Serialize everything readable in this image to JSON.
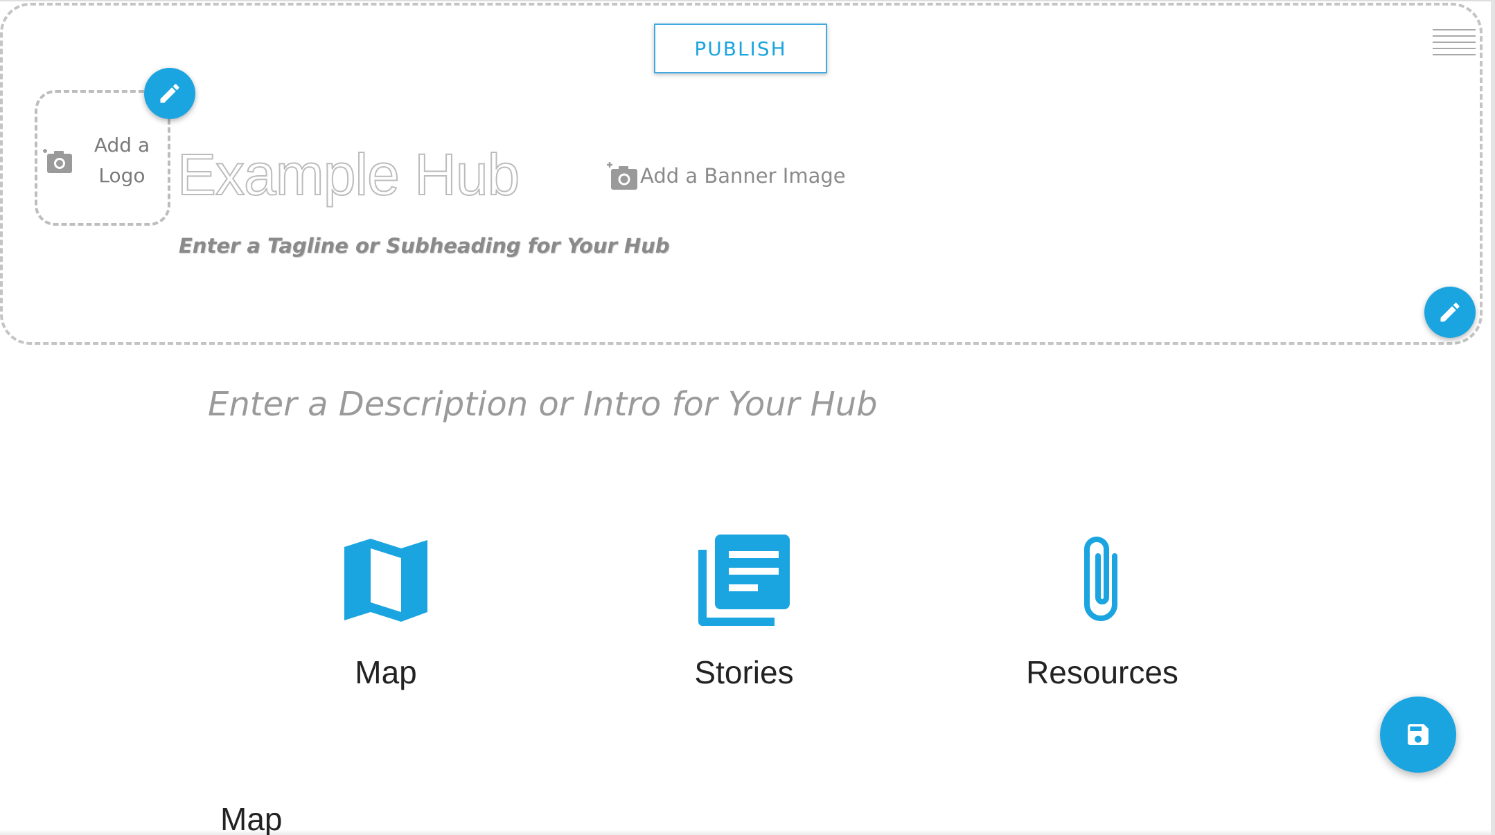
{
  "header": {
    "publish_label": "PUBLISH",
    "logo_label_line1": "Add a",
    "logo_label_line2": "Logo",
    "title": "Example Hub",
    "tagline": "Enter a Tagline or Subheading for Your Hub",
    "banner_label": "Add a Banner Image"
  },
  "main": {
    "description": "Enter a Description or Intro for Your Hub",
    "features": [
      {
        "label": "Map",
        "icon": "map-icon"
      },
      {
        "label": "Stories",
        "icon": "stories-icon"
      },
      {
        "label": "Resources",
        "icon": "paperclip-icon"
      }
    ],
    "section_title": "Map"
  },
  "colors": {
    "accent": "#1ba5e0",
    "placeholder_text": "#9a9a9a",
    "dashed_border": "#c4c4c4"
  }
}
